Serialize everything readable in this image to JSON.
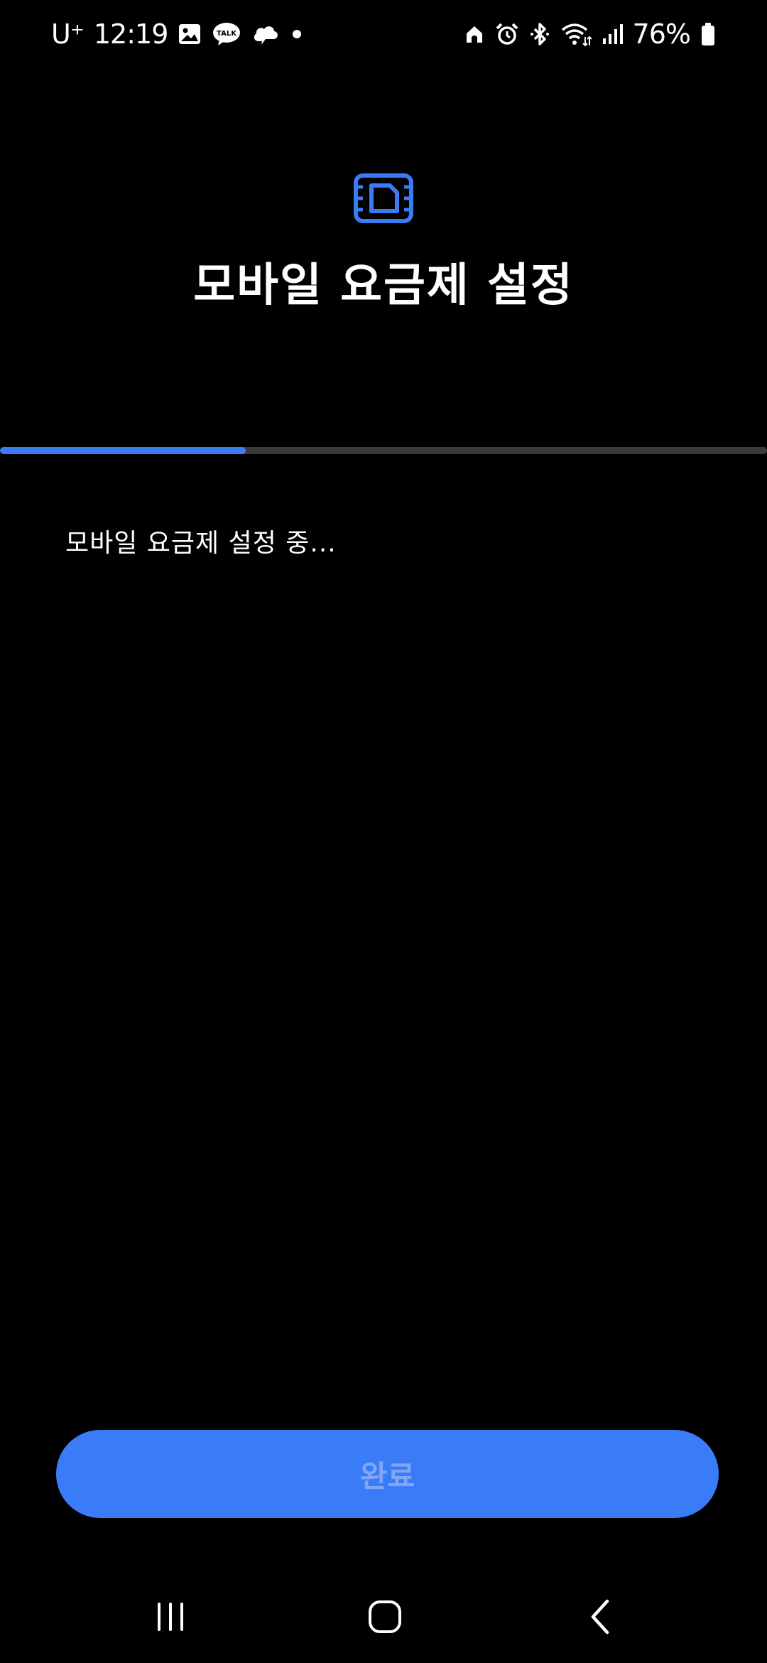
{
  "status_bar": {
    "carrier": "U⁺",
    "time": "12:19",
    "battery": "76%",
    "notification_icons": [
      "gallery-icon",
      "kakaotalk-icon",
      "cloud-icon",
      "dot-icon"
    ],
    "system_icons": [
      "home-icon",
      "alarm-icon",
      "bluetooth-icon",
      "wifi-icon",
      "signal-icon",
      "battery-icon"
    ]
  },
  "header": {
    "icon": "sim-card-icon",
    "title": "모바일 요금제 설정"
  },
  "progress": {
    "value": 0.32,
    "colors": {
      "fill": "#3b7cf6",
      "track": "#3a3a3a"
    }
  },
  "main": {
    "message": "모바일 요금제 설정 중..."
  },
  "footer": {
    "done_label": "완료",
    "done_enabled": false
  },
  "nav": {
    "items": [
      "recents-icon",
      "home-button-icon",
      "back-icon"
    ]
  },
  "colors": {
    "background": "#000000",
    "accent": "#3b7cf6",
    "text": "#ffffff"
  }
}
